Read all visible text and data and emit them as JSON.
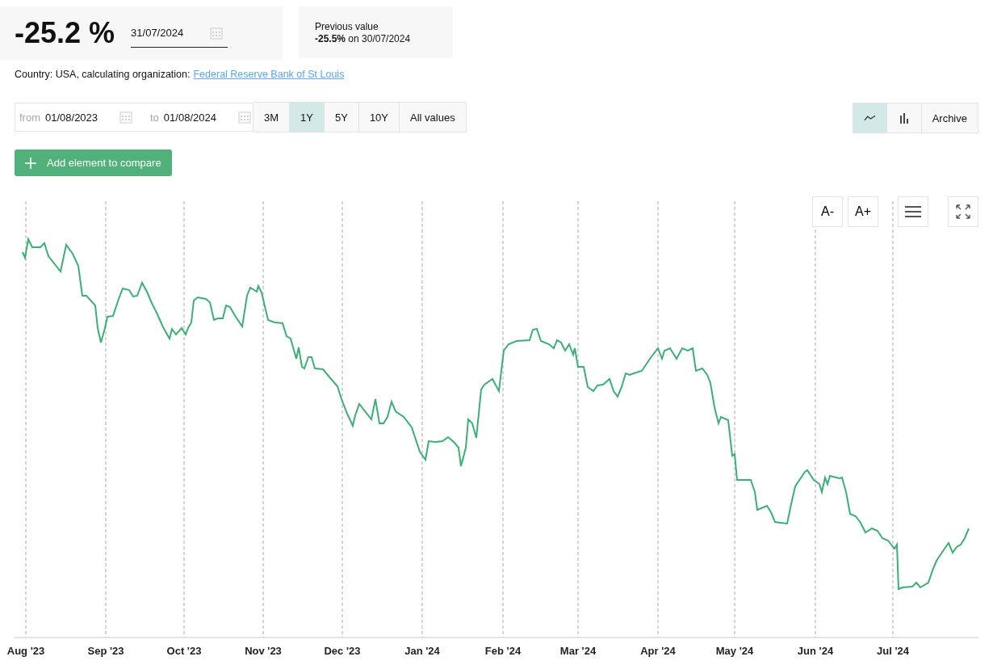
{
  "indicator": {
    "value": "-25.2 %",
    "date": "31/07/2024"
  },
  "previous": {
    "label": "Previous value",
    "text": "**-25.5%** on 30/07/2024"
  },
  "source": {
    "text": "Country: USA, calculating organization:",
    "link": "Federal Reserve Bank of St Louis"
  },
  "range": {
    "from_label": "from",
    "from": "01/08/2023",
    "to_label": "to",
    "to": "01/08/2024"
  },
  "periods": [
    {
      "label": "3M",
      "selected": false
    },
    {
      "label": "1Y",
      "selected": true
    },
    {
      "label": "5Y",
      "selected": false
    },
    {
      "label": "10Y",
      "selected": false
    },
    {
      "label": "All values",
      "selected": false
    }
  ],
  "chart_types": [
    {
      "kind": "line",
      "selected": true
    },
    {
      "kind": "bar",
      "selected": false
    }
  ],
  "archive_button": "Archive",
  "compare_button": "Add element to compare",
  "chart_tools": [
    "A-",
    "A+"
  ],
  "x_labels": [
    "Aug '23",
    "Sep '23",
    "Oct '23",
    "Nov '23",
    "Dec '23",
    "Jan '24",
    "Feb '24",
    "Mar '24",
    "Apr '24",
    "May '24",
    "Jun '24",
    "Jul '24"
  ]
}
